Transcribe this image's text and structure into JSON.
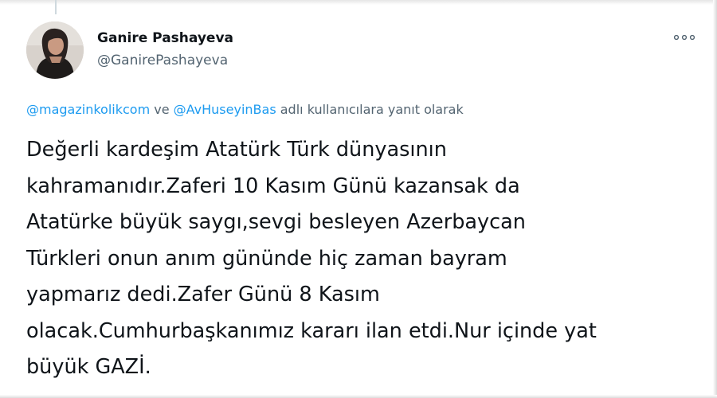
{
  "tweet": {
    "author": {
      "display_name": "Ganire Pashayeva",
      "handle": "@GanirePashayeva",
      "avatar_icon": "profile-photo"
    },
    "more_icon": "more-dots-icon",
    "reply_context": {
      "mention_1": "@magazinkolikcom",
      "connector": "ve",
      "mention_2": "@AvHuseyinBas",
      "suffix": "adlı kullanıcılara yanıt olarak"
    },
    "text_lines": [
      "Değerli kardeşim Atatürk Türk dünyasının",
      "kahramanıdır.Zaferi 10 Kasım Günü kazansak da",
      "Atatürke büyük saygı,sevgi besleyen Azerbaycan",
      "Türkleri onun anım gününde hiç zaman bayram",
      "yapmarız dedi.Zafer Günü 8 Kasım",
      "olacak.Cumhurbaşkanımız kararı ilan etdi.Nur içinde yat",
      "büyük GAZİ."
    ]
  },
  "colors": {
    "text_primary": "#0f1419",
    "text_secondary": "#536471",
    "link": "#1d9bf0"
  }
}
